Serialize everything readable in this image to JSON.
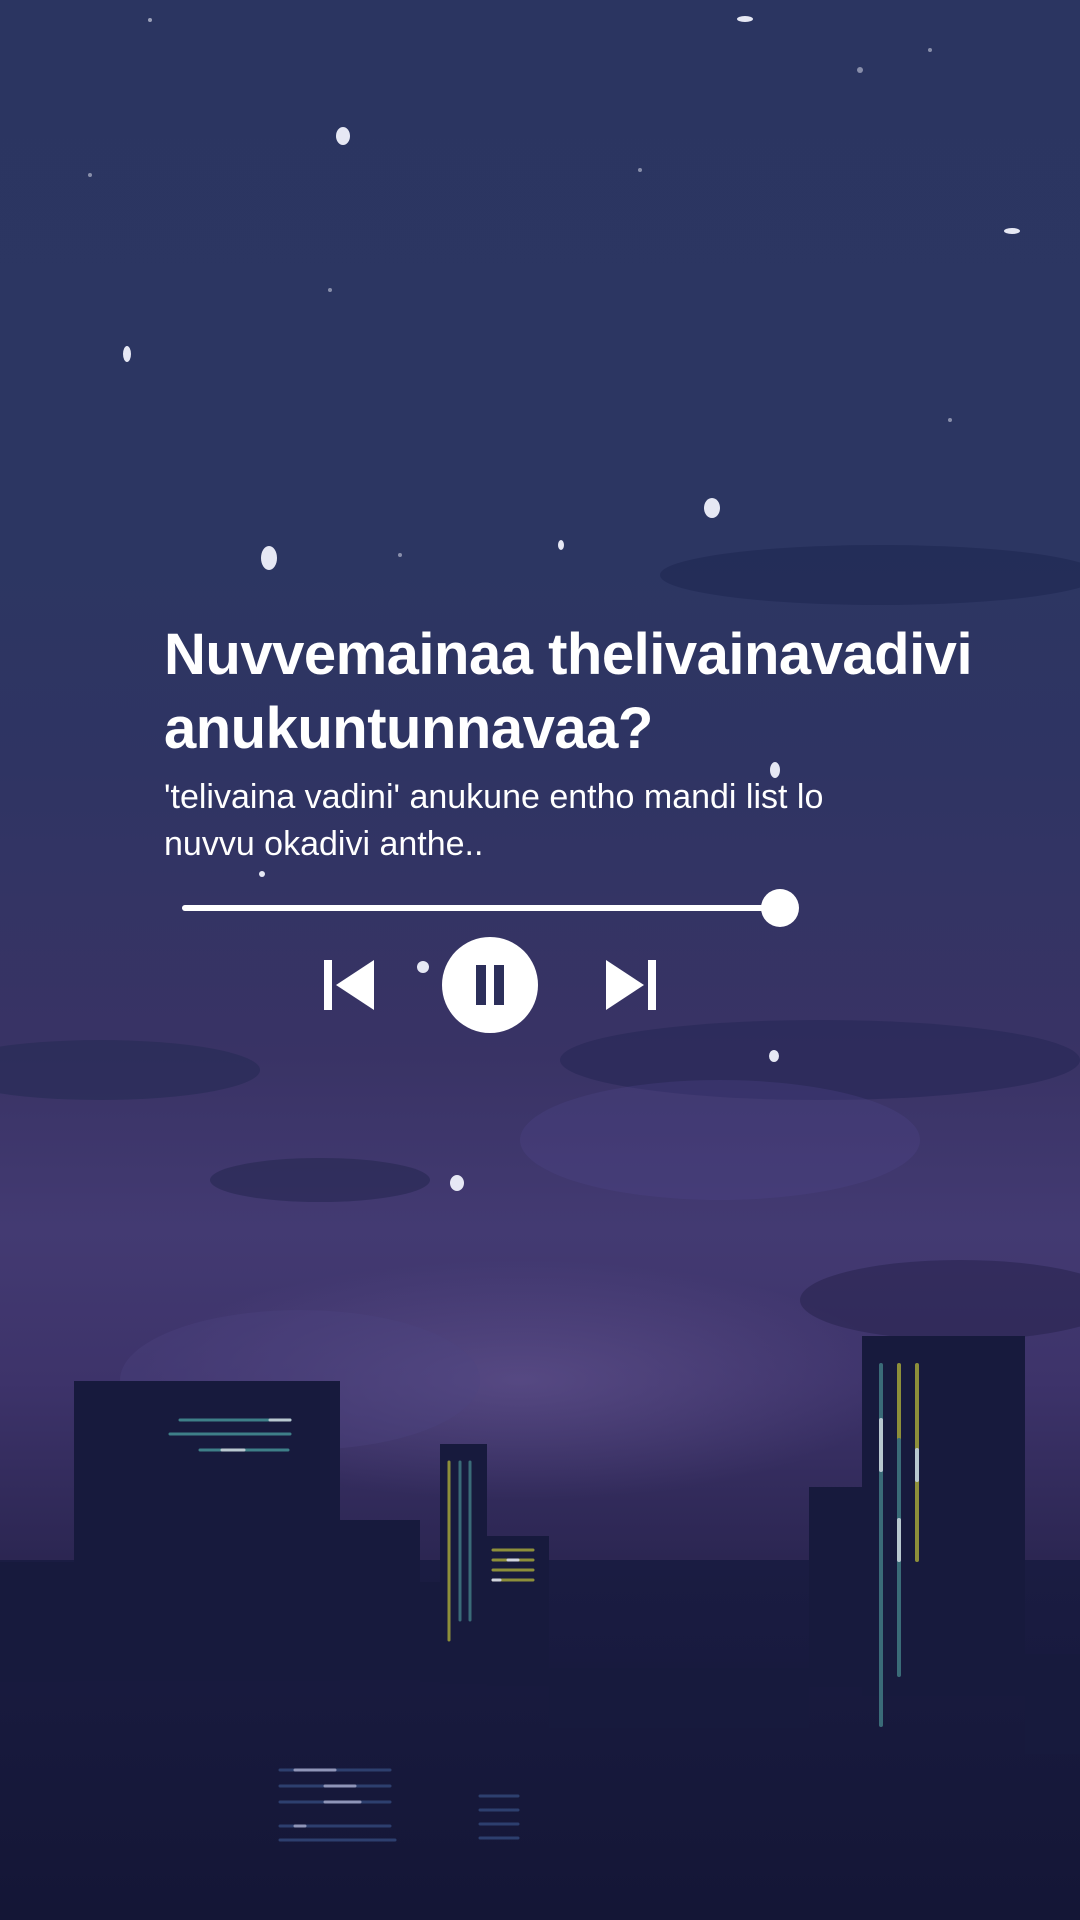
{
  "track": {
    "title": "Nuvvemainaa thelivainavadivi\nanukuntunnavaa?",
    "subtitle": "'telivaina vadini' anukune entho mandi list lo\nnuvvu okadivi anthe.."
  },
  "player": {
    "progress": 0.97,
    "state": "playing",
    "prev_icon": "skip-previous-icon",
    "play_pause_icon": "pause-icon",
    "next_icon": "skip-next-icon"
  },
  "colors": {
    "text": "#ffffff",
    "sky_top": "#2b3561",
    "sky_mid": "#433a72",
    "buildings": "#171a3d"
  }
}
